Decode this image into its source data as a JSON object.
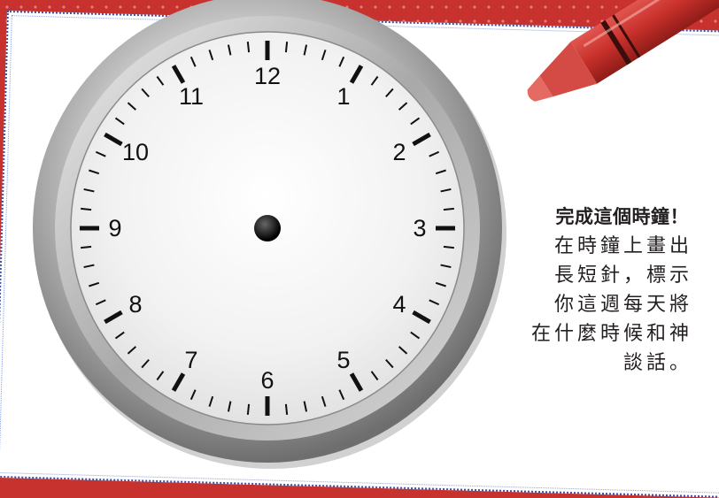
{
  "clock": {
    "numerals": [
      "12",
      "1",
      "2",
      "3",
      "4",
      "5",
      "6",
      "7",
      "8",
      "9",
      "10",
      "11"
    ]
  },
  "instruction": {
    "title": "完成這個時鐘！",
    "body": "在時鐘上畫出\n長短針，標示\n你這週每天將\n在什麼時候和神\n談話。"
  },
  "colors": {
    "background": "#c8322e",
    "paper_border": "#3a4fa8",
    "crayon": "#c8302b",
    "clock_bezel": "#9a9a9a"
  },
  "icons": [
    "crayon-icon",
    "clock-icon"
  ]
}
